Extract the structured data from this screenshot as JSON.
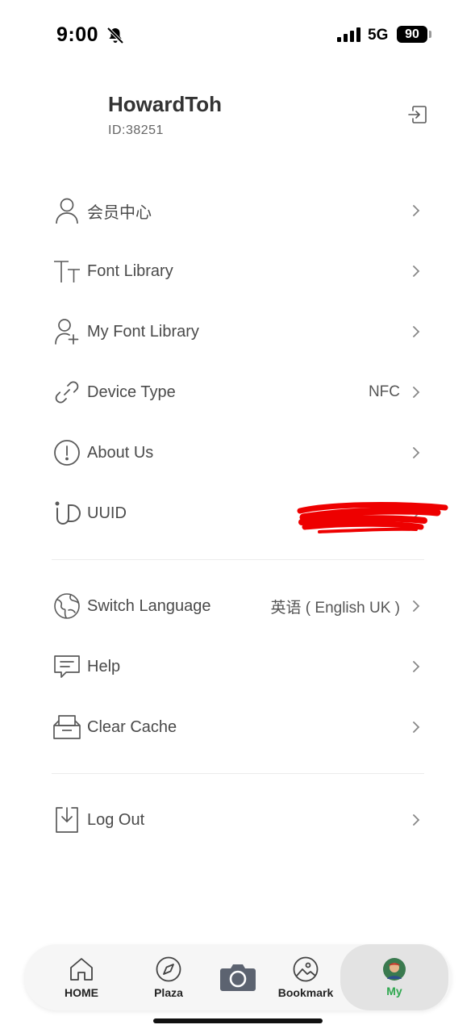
{
  "status_bar": {
    "time": "9:00",
    "network": "5G",
    "battery": "90"
  },
  "profile": {
    "name": "HowardToh",
    "id": "ID:38251"
  },
  "menu": {
    "member_center": "会员中心",
    "font_library": "Font Library",
    "my_font_library": "My Font Library",
    "device_type": {
      "label": "Device Type",
      "value": "NFC"
    },
    "about_us": "About Us",
    "uuid": "UUID",
    "switch_language": {
      "label": "Switch Language",
      "value": "英语 ( English UK )"
    },
    "help": "Help",
    "clear_cache": "Clear Cache",
    "log_out": "Log Out"
  },
  "tabbar": {
    "home": "HOME",
    "plaza": "Plaza",
    "bookmark": "Bookmark",
    "my": "My"
  },
  "colors": {
    "accent": "#2fa84f",
    "icon": "#5a5a5a",
    "redaction": "#ee0000"
  },
  "icons": [
    "bell-slash-icon",
    "signal-icon",
    "login-icon",
    "user-icon",
    "font-icon",
    "user-add-icon",
    "link-icon",
    "info-icon",
    "uuid-icon",
    "globe-icon",
    "message-icon",
    "box-icon",
    "download-icon",
    "chevron-right-icon",
    "home-icon",
    "compass-icon",
    "camera-icon",
    "gallery-icon",
    "avatar"
  ]
}
